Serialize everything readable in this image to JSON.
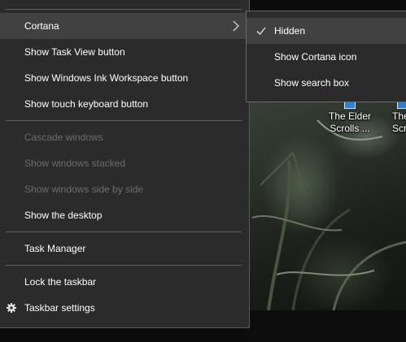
{
  "context_menu": {
    "items": [
      {
        "label": "Cortana",
        "has_submenu": true,
        "highlighted": true
      },
      {
        "label": "Show Task View button"
      },
      {
        "label": "Show Windows Ink Workspace button"
      },
      {
        "label": "Show touch keyboard button"
      },
      {
        "label": "Cascade windows",
        "disabled": true
      },
      {
        "label": "Show windows stacked",
        "disabled": true
      },
      {
        "label": "Show windows side by side",
        "disabled": true
      },
      {
        "label": "Show the desktop"
      },
      {
        "label": "Task Manager"
      },
      {
        "label": "Lock the taskbar"
      },
      {
        "label": "Taskbar settings",
        "icon": "gear-icon"
      }
    ]
  },
  "cortana_submenu": {
    "items": [
      {
        "label": "Hidden",
        "checked": true,
        "highlighted": true
      },
      {
        "label": "Show Cortana icon"
      },
      {
        "label": "Show search box"
      }
    ]
  },
  "desktop_icons": [
    {
      "line1": "The Elder",
      "line2": "Scrolls ..."
    },
    {
      "line1": "The",
      "line2": "Scr"
    }
  ],
  "colors": {
    "menu_background": "#2b2b2b",
    "highlight_background": "#414141",
    "text": "#ffffff",
    "disabled_text": "#6d6d6d",
    "separator": "#5f5f5f"
  }
}
